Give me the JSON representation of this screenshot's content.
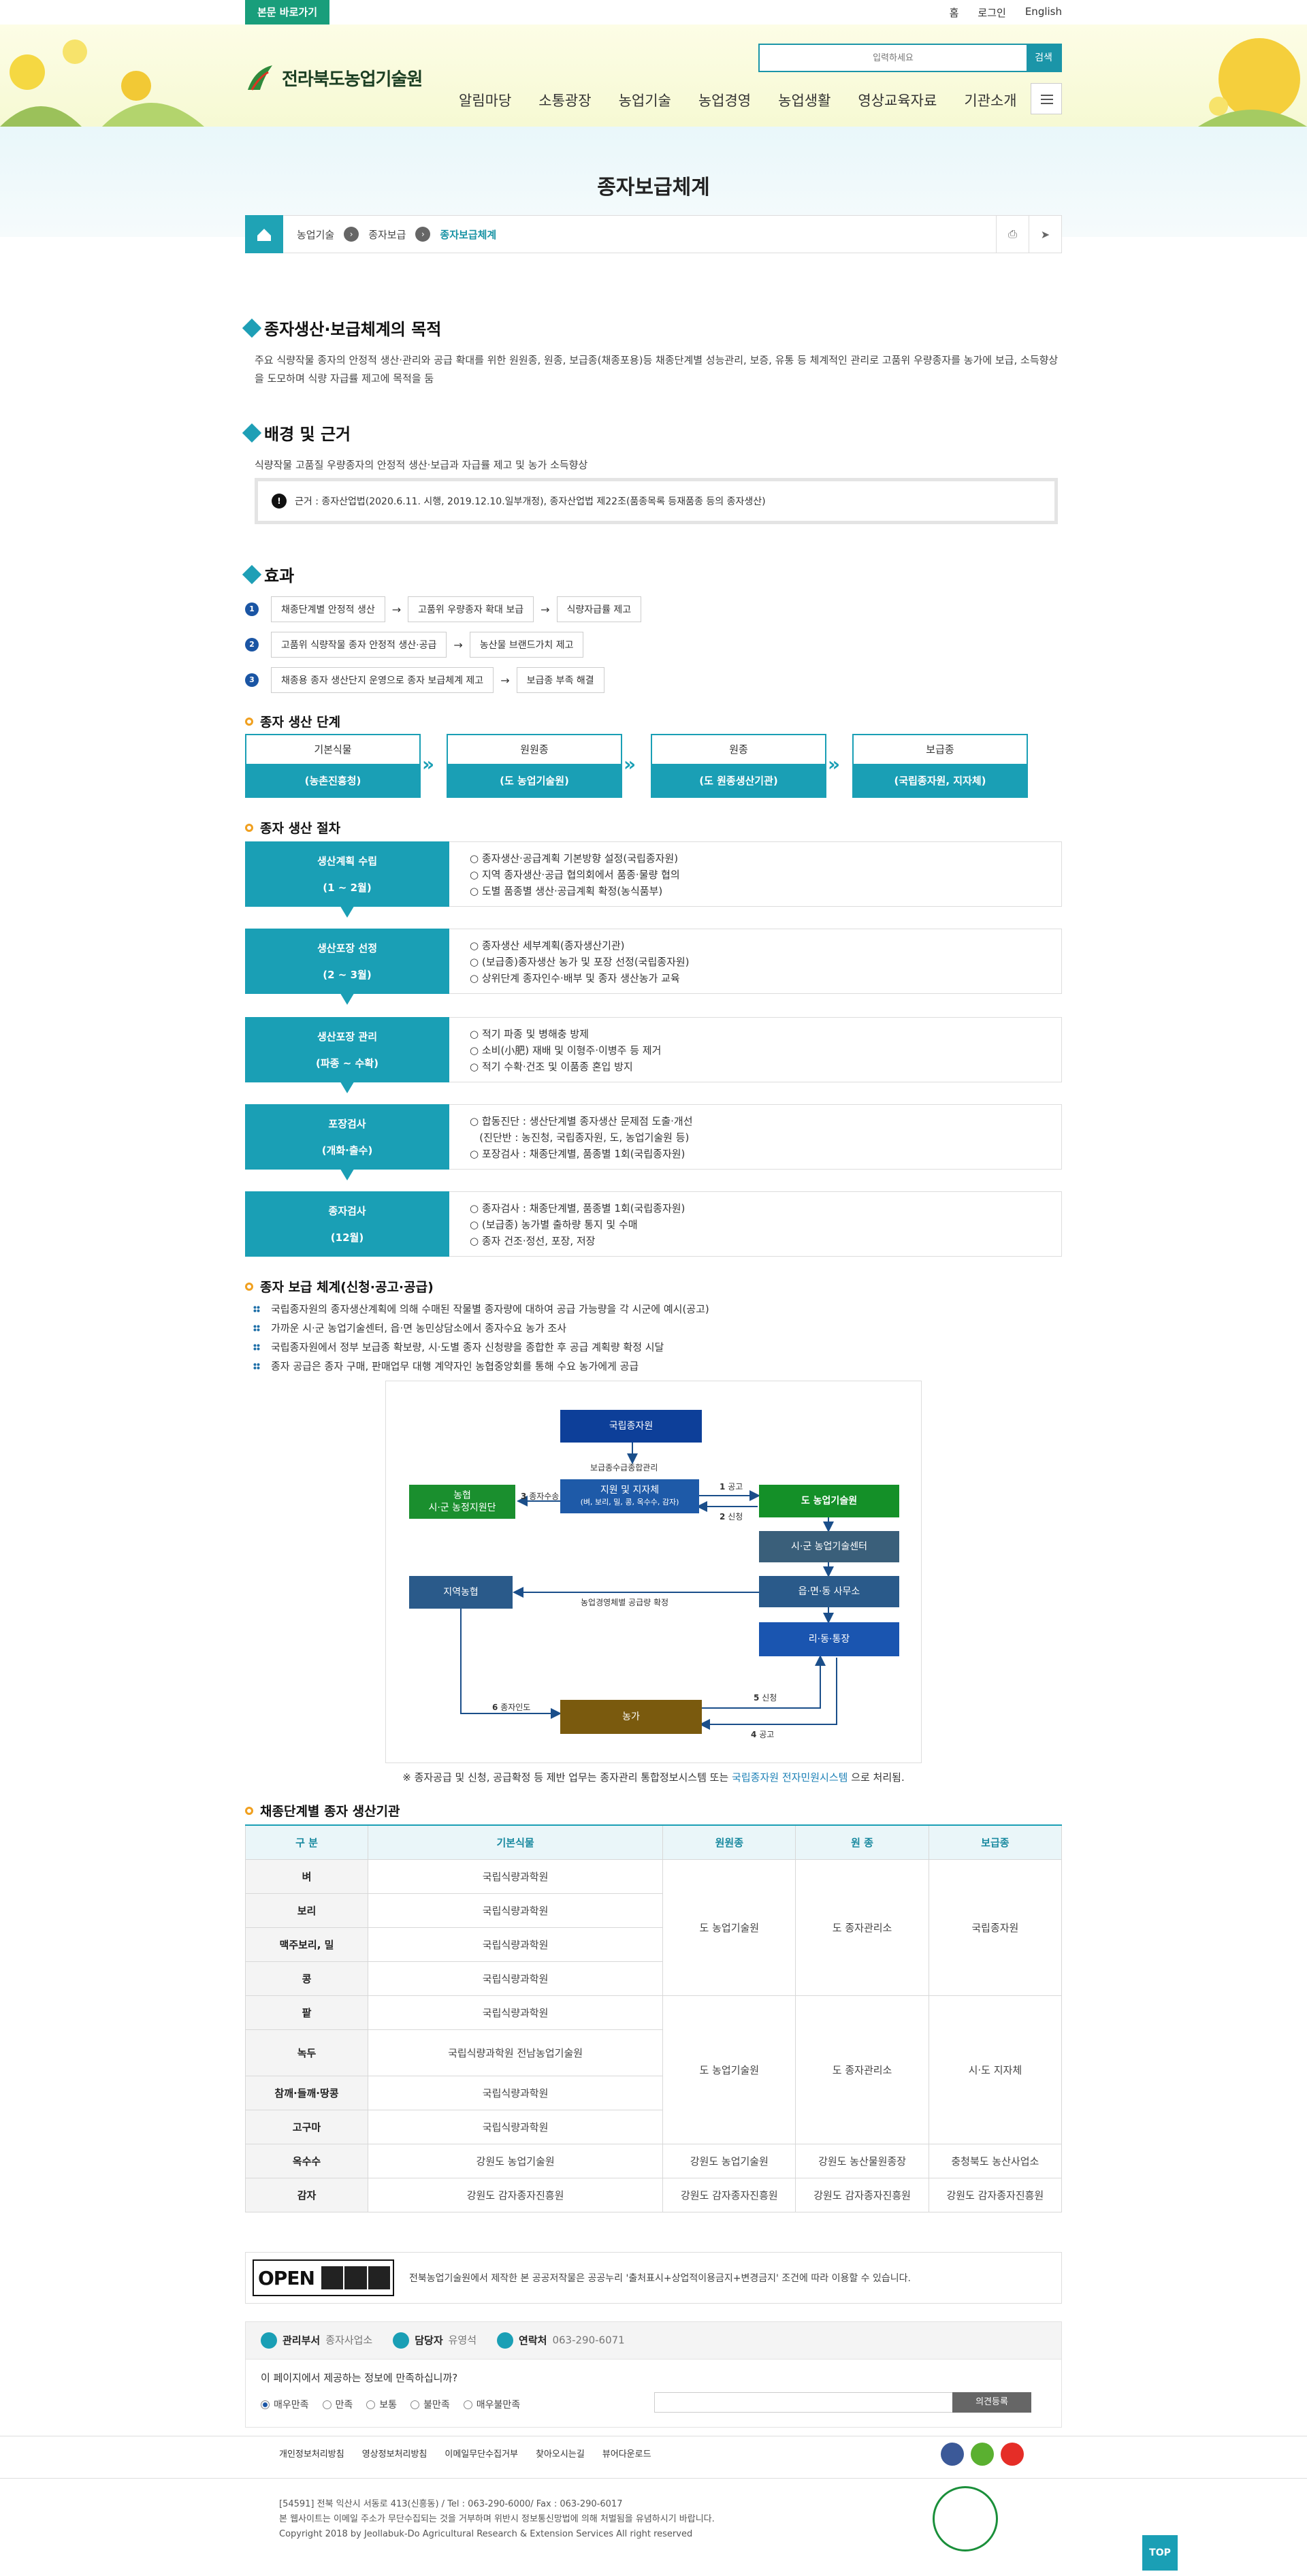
{
  "header": {
    "skip": "본문 바로가기",
    "top_links": [
      "홈",
      "로그인",
      "English"
    ],
    "logo_text": "전라북도농업기술원",
    "search_placeholder": "입력하세요",
    "search_button": "검색",
    "gnb": [
      "알림마당",
      "소통광장",
      "농업기술",
      "농업경영",
      "농업생활",
      "영상교육자료",
      "기관소개"
    ]
  },
  "page_title": "종자보급체계",
  "breadcrumb": [
    "농업기술",
    "종자보급",
    "종자보급체계"
  ],
  "sections": {
    "purpose_title": "종자생산·보급체계의 목적",
    "purpose_text": "주요 식량작물 종자의 안정적 생산·관리와 공급 확대를 위한 원원종, 원종, 보급종(채종포용)등 채종단계별 성능관리, 보증, 유통 등 체계적인 관리로 고품위 우량종자를 농가에 보급, 소득향상을 도모하며 식량 자급률 제고에 목적을 둠",
    "background_title": "배경 및 근거",
    "background_text": "식량작물 고품질 우량종자의 안정적 생산·보급과 자급률 제고 및 농가 소득향상",
    "basis": "근거 : 종자산업법(2020.6.11. 시행, 2019.12.10.일부개정), 종자산업법 제22조(품종목록 등재품종 등의 종자생산)",
    "effect_title": "효과",
    "effects": [
      [
        "채종단계별 안정적 생산",
        "고품위 우량종자 확대 보급",
        "식량자급률 제고"
      ],
      [
        "고품위 식량작물 종자 안정적 생산·공급",
        "농산물 브랜드가치 제고"
      ],
      [
        "채종용 종자 생산단지 운영으로 종자 보급체계 제고",
        "보급종 부족 해결"
      ]
    ]
  },
  "stages_title": "종자 생산 단계",
  "stages": [
    {
      "top": "기본식물",
      "bottom": "(농촌진흥청)"
    },
    {
      "top": "원원종",
      "bottom": "(도 농업기술원)"
    },
    {
      "top": "원종",
      "bottom": "(도 원종생산기관)"
    },
    {
      "top": "보급종",
      "bottom": "(국립종자원, 지자체)"
    }
  ],
  "procedure_title": "종자 생산 절차",
  "procedures": [
    {
      "name": "생산계획 수립",
      "period": "(1 ~ 2월)",
      "items": [
        "○ 종자생산·공급계획 기본방향 설정(국립종자원)",
        "○ 지역 종자생산·공급 협의회에서 품종·물량 협의",
        "○ 도별 품종별 생산·공급계획 확정(농식품부)"
      ]
    },
    {
      "name": "생산포장 선정",
      "period": "(2 ~ 3월)",
      "items": [
        "○ 종자생산 세부계획(종자생산기관)",
        "○ (보급종)종자생산 농가 및 포장 선정(국립종자원)",
        "○ 상위단계 종자인수·배부 및 종자 생산농가 교육"
      ]
    },
    {
      "name": "생산포장 관리",
      "period": "(파종 ~ 수확)",
      "items": [
        "○ 적기 파종 및 병해충 방제",
        "○ 소비(小肥) 재배 및 이형주·이병주 등 제거",
        "○ 적기 수확·건조 및 이품종 혼입 방지"
      ]
    },
    {
      "name": "포장검사",
      "period": "(개화·출수)",
      "items": [
        "○ 합동진단 : 생산단계별 종자생산 문제점 도출·개선",
        "   (진단반 : 농진청, 국립종자원, 도, 농업기술원 등)",
        "○ 포장검사 : 채종단계별, 품종별 1회(국립종자원)"
      ]
    },
    {
      "name": "종자검사",
      "period": "(12월)",
      "items": [
        "○ 종자검사 : 채종단계별, 품종별 1회(국립종자원)",
        "○ (보급종) 농가별 출하량 통지 및 수매",
        "○ 종자 건조·정선, 포장, 저장"
      ]
    }
  ],
  "supply_title": "종자 보급 체계(신청·공고·공급)",
  "supply_bullets": [
    "국립종자원의 종자생산계획에 의해 수매된 작물별 종자량에 대하여 공급 가능량을 각 시군에 예시(공고)",
    "가까운 시·군 농업기술센터, 읍·면 농민상담소에서 종자수요 농가 조사",
    "국립종자원에서 정부 보급종 확보량, 시·도별 종자 신청량을 종합한 후 공급 계획량 확정 시달",
    "종자 공급은 종자 구매, 판매업무 대행 계약자인 농협중앙회를 통해 수요 농가에게 공급"
  ],
  "diagram": {
    "nodes": {
      "nisc": "국립종자원",
      "branch": "지원 및 지자체",
      "branch_sub": "(벼, 보리, 밀, 콩, 옥수수, 감자)",
      "nh": "농협",
      "nh_sub": "시·군 농정지원단",
      "ari": "도 농업기술원",
      "center": "시·군 농업기술센터",
      "local_nh": "지역농협",
      "office": "읍·면·동 사무소",
      "village": "리·동·통장",
      "farmer": "농가"
    },
    "labels": {
      "plan": "보급종수급종합관리",
      "notice": "공고",
      "apply": "신청",
      "supply": "종자수송",
      "confirm": "농업경영체별 공급량 확정",
      "deliver": "종자인도",
      "apply2": "신청",
      "notice2": "공고"
    },
    "nums": {
      "n1": "1",
      "n2": "2",
      "n3": "3",
      "n4": "4",
      "n5": "5",
      "n6": "6"
    }
  },
  "note": {
    "text": "※ 종자공급 및 신청, 공급확정 등 제반 업무는 종자관리 통합정보시스템 또는 ",
    "link": "국립종자원 전자민원시스템",
    "suffix": " 으로 처리됨."
  },
  "org_title": "채종단계별 종자 생산기관",
  "org_table": {
    "headers": [
      "구 분",
      "기본식물",
      "원원종",
      "원 종",
      "보급종"
    ],
    "g1_rows": [
      [
        "벼",
        "국립식량과학원"
      ],
      [
        "보리",
        "국립식량과학원"
      ],
      [
        "맥주보리, 밀",
        "국립식량과학원"
      ],
      [
        "콩",
        "국립식량과학원"
      ]
    ],
    "g1_merge": [
      "도 농업기술원",
      "도 종자관리소",
      "국립종자원"
    ],
    "g2_rows": [
      [
        "팥",
        "국립식량과학원"
      ],
      [
        "녹두",
        "국립식량과학원 전남농업기술원"
      ],
      [
        "참깨·들깨·땅콩",
        "국립식량과학원"
      ],
      [
        "고구마",
        "국립식량과학원"
      ]
    ],
    "g2_merge": [
      "도 농업기술원",
      "도 종자관리소",
      "시·도 지자체"
    ],
    "extra_rows": [
      [
        "옥수수",
        "강원도 농업기술원",
        "강원도 농업기술원",
        "강원도 농산물원종장",
        "충청북도 농산사업소"
      ],
      [
        "감자",
        "강원도 감자종자진흥원",
        "강원도 감자종자진흥원",
        "강원도 감자종자진흥원",
        "강원도 감자종자진흥원"
      ]
    ]
  },
  "open": {
    "logo": "OPEN",
    "text": "전북농업기술원에서 제작한 본 공공저작물은 공공누리 '출처표시+상업적이용금지+변경금지' 조건에 따라 이용할 수 있습니다."
  },
  "manager": {
    "dept_label": "관리부서",
    "dept": "종자사업소",
    "person_label": "담당자",
    "person": "유영석",
    "phone_label": "연락처",
    "phone": "063-290-6071"
  },
  "satisfaction": {
    "question": "이 페이지에서 제공하는 정보에 만족하십니까?",
    "options": [
      "매우만족",
      "만족",
      "보통",
      "불만족",
      "매우불만족"
    ],
    "submit": "의견등록"
  },
  "footer": {
    "links": [
      "개인정보처리방침",
      "영상정보처리방침",
      "이메일무단수집거부",
      "찾아오시는길",
      "뷰어다운로드"
    ],
    "addr1": "[54591] 전북 익산시 서동로 413(신흥동) / Tel : 063-290-6000/ Fax : 063-290-6017",
    "addr2": "본 웹사이트는 이메일 주소가 무단수집되는 것을 거부하며 위반시 정보통신망법에 의해 처벌됨을 유념하시기 바랍니다.",
    "copy": "Copyright 2018 by Jeollabuk-Do Agricultural Research & Extension Services All right reserved"
  },
  "top_button": "TOP",
  "colors": {
    "accent": "#1a9fb5",
    "green": "#1a8f3a",
    "navy": "#1a4e8a",
    "brown": "#7a5a0e"
  }
}
